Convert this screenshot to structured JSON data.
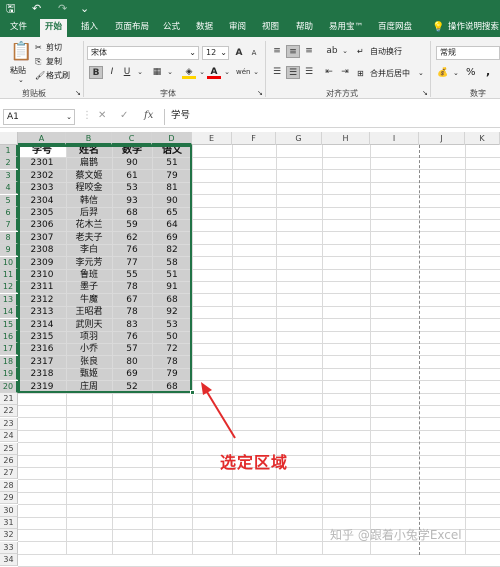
{
  "quick_access": {
    "save": "🖫",
    "undo": "↶",
    "redo": "↷",
    "customize": "⌄"
  },
  "tabs": [
    "文件",
    "开始",
    "插入",
    "页面布局",
    "公式",
    "数据",
    "审阅",
    "视图",
    "帮助",
    "易用宝™",
    "百度网盘",
    "操作说明搜索"
  ],
  "ribbon": {
    "clipboard": {
      "paste": "粘贴",
      "cut": "剪切",
      "copy": "复制",
      "format_painter": "格式刷",
      "group": "剪贴板"
    },
    "font": {
      "name": "宋体",
      "size": "12",
      "grow": "A",
      "shrink": "A",
      "bold": "B",
      "italic": "I",
      "underline": "U",
      "wen": "wén",
      "group": "字体"
    },
    "alignment": {
      "wrap": "自动换行",
      "merge": "合并后居中",
      "group": "对齐方式"
    },
    "number": {
      "format": "常规",
      "percent": "%",
      "comma": ",",
      "group": "数字"
    }
  },
  "formula_bar": {
    "name_box": "A1",
    "cancel": "✕",
    "confirm": "✓",
    "fx": "fx",
    "formula": "学号"
  },
  "columns": [
    "A",
    "B",
    "C",
    "D",
    "E",
    "F",
    "G",
    "H",
    "I",
    "J",
    "K"
  ],
  "rows": [
    "1",
    "2",
    "3",
    "4",
    "5",
    "6",
    "7",
    "8",
    "9",
    "10",
    "11",
    "12",
    "13",
    "14",
    "15",
    "16",
    "17",
    "18",
    "19",
    "20",
    "21",
    "22",
    "23",
    "24",
    "25",
    "26",
    "27",
    "28",
    "29",
    "30",
    "31",
    "32",
    "33",
    "34"
  ],
  "table": {
    "headers": [
      "学号",
      "姓名",
      "数学",
      "语文"
    ],
    "rows": [
      [
        "2301",
        "扁鹊",
        "90",
        "51"
      ],
      [
        "2302",
        "蔡文姬",
        "61",
        "79"
      ],
      [
        "2303",
        "程咬金",
        "53",
        "81"
      ],
      [
        "2304",
        "韩信",
        "93",
        "90"
      ],
      [
        "2305",
        "后羿",
        "68",
        "65"
      ],
      [
        "2306",
        "花木兰",
        "59",
        "64"
      ],
      [
        "2307",
        "老夫子",
        "62",
        "69"
      ],
      [
        "2308",
        "李白",
        "76",
        "82"
      ],
      [
        "2309",
        "李元芳",
        "77",
        "58"
      ],
      [
        "2310",
        "鲁班",
        "55",
        "51"
      ],
      [
        "2311",
        "墨子",
        "78",
        "91"
      ],
      [
        "2312",
        "牛魔",
        "67",
        "68"
      ],
      [
        "2313",
        "王昭君",
        "78",
        "92"
      ],
      [
        "2314",
        "武则天",
        "83",
        "53"
      ],
      [
        "2315",
        "项羽",
        "76",
        "50"
      ],
      [
        "2316",
        "小乔",
        "57",
        "72"
      ],
      [
        "2317",
        "张良",
        "80",
        "78"
      ],
      [
        "2318",
        "甄姬",
        "69",
        "79"
      ],
      [
        "2319",
        "庄周",
        "52",
        "68"
      ]
    ]
  },
  "annotation": {
    "text": "选定区域",
    "color": "#e22b2b"
  },
  "watermark": "知乎 @跟着小兔学Excel",
  "colors": {
    "brand": "#217346",
    "selection": "#cfcfcf"
  }
}
